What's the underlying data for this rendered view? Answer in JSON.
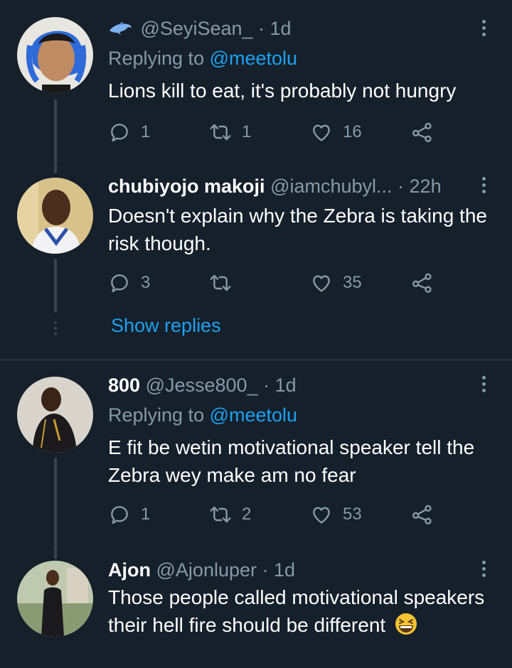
{
  "tweets": [
    {
      "handle_prefix_icon": "dolphin-emoji",
      "name": "",
      "handle": "@SeyiSean_",
      "time": "· 1d",
      "replying_label": "Replying to",
      "replying_to": "@meetolu",
      "text": "Lions kill to eat, it's probably not hungry",
      "replies": "1",
      "retweets": "1",
      "likes": "16"
    },
    {
      "name": "chubiyojo makoji",
      "handle": "@iamchubyl...",
      "time": "· 22h",
      "text": "Doesn't explain why the Zebra is taking the risk though.",
      "replies": "3",
      "retweets": "",
      "likes": "35",
      "show_replies": "Show replies"
    },
    {
      "name": "800",
      "handle": "@Jesse800_",
      "time": "· 1d",
      "replying_label": "Replying to",
      "replying_to": "@meetolu",
      "text": "E fit be wetin motivational speaker tell the Zebra wey make am no fear",
      "replies": "1",
      "retweets": "2",
      "likes": "53"
    },
    {
      "name": "Ajon",
      "handle": "@Ajonluper",
      "time": "· 1d",
      "text": "Those people called motivational speakers their hell fire should be different",
      "emoji": "grinning-squinting-face"
    }
  ],
  "colors": {
    "background": "#15202b",
    "secondary_text": "#8899a6",
    "accent": "#1da1f2",
    "divider": "#38444d"
  }
}
